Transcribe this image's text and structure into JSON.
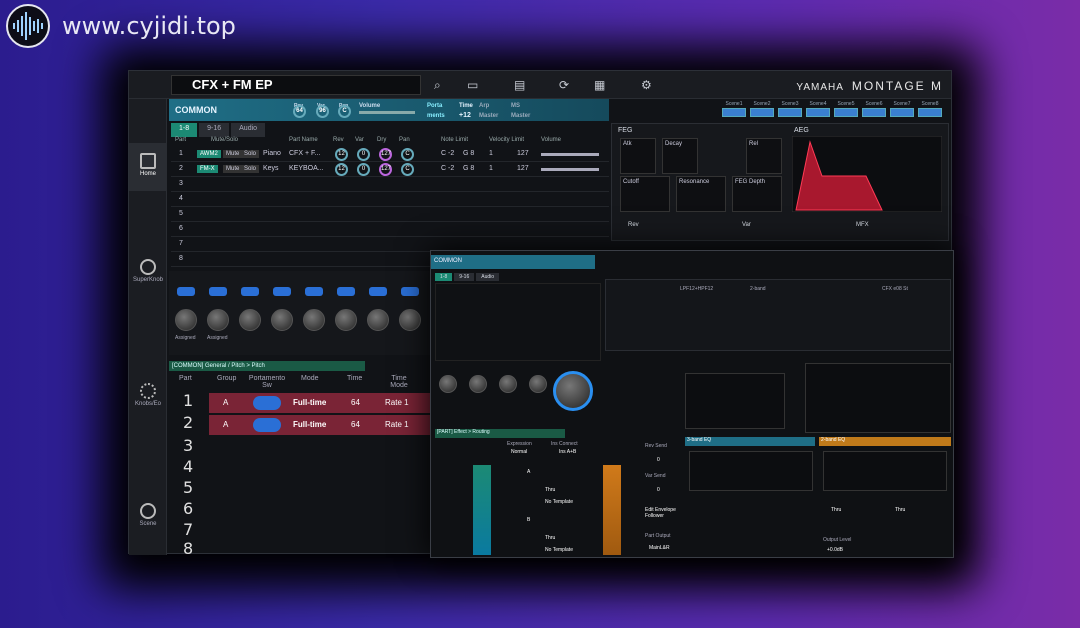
{
  "site": {
    "url": "www.cyjidi.top"
  },
  "topbar": {
    "performance_name": "CFX + FM EP",
    "brand": "YAMAHA",
    "model": "MONTAGE M"
  },
  "sidebar": {
    "items": [
      {
        "label": "Home"
      },
      {
        "label": "SuperKnob"
      },
      {
        "label": "Knobs/Eo"
      },
      {
        "label": "Scene"
      }
    ]
  },
  "common_bar": {
    "label": "COMMON",
    "rev_label": "Rev",
    "rev_value": "64",
    "var_label": "Var",
    "var_value": "96",
    "pan_label": "Pan",
    "pan_value": "C",
    "volume_label": "Volume",
    "porta_label": "Porta",
    "porta_value": "ments",
    "time_label": "Time",
    "time_value": "+12",
    "arp_label": "Arp",
    "arp_value": "Master",
    "ms_label": "MS",
    "ms_value": "Master"
  },
  "scenes": [
    "Scene1",
    "Scene2",
    "Scene3",
    "Scene4",
    "Scene5",
    "Scene6",
    "Scene7",
    "Scene8"
  ],
  "tabs": [
    "1-8",
    "9-16",
    "Audio"
  ],
  "part_table": {
    "headers": [
      "Part",
      "Mute/Solo",
      "Part Name",
      "Rev",
      "Var",
      "Dry",
      "Pan",
      "Note Limit",
      "Velocity Limit",
      "Volume"
    ],
    "rows": [
      {
        "num": "1",
        "type": "AWM2",
        "mute": "Mute",
        "solo": "Solo",
        "cat": "Piano",
        "name": "CFX + F...",
        "rev": "12",
        "var": "0",
        "dry": "127",
        "pan": "C",
        "note_lo": "C -2",
        "note_hi": "G 8",
        "vel_lo": "1",
        "vel_hi": "127"
      },
      {
        "num": "2",
        "type": "FM-X",
        "mute": "Mute",
        "solo": "Solo",
        "cat": "Keys",
        "name": "KEYBOA...",
        "rev": "12",
        "var": "0",
        "dry": "127",
        "pan": "C",
        "note_lo": "C -2",
        "note_hi": "G 8",
        "vel_lo": "1",
        "vel_hi": "127"
      }
    ],
    "empty_rows": [
      "3",
      "4",
      "5",
      "6",
      "7",
      "8"
    ]
  },
  "knob_labels": [
    "Assigned",
    "Assigned"
  ],
  "general": {
    "title": "[COMMON] General / Pitch > Pitch",
    "headers": [
      "Part",
      "Group",
      "Portamento Sw",
      "Mode",
      "Time",
      "Time Mode"
    ],
    "rows": [
      {
        "num": "1",
        "group": "A",
        "mode": "Full-time",
        "time": "64",
        "time_mode": "Rate 1"
      },
      {
        "num": "2",
        "group": "A",
        "mode": "Full-time",
        "time": "64",
        "time_mode": "Rate 1"
      }
    ],
    "empty_rows": [
      "3",
      "4",
      "5",
      "6",
      "7",
      "8"
    ]
  },
  "feg": {
    "title": "FEG",
    "atk": "Atk",
    "decay": "Decay",
    "rel": "Rel",
    "cutoff": "Cutoff",
    "resonance": "Resonance",
    "depth": "FEG Depth"
  },
  "aeg": {
    "title": "AEG"
  },
  "fx_row": {
    "rev": "Rev",
    "var": "Var",
    "mfx": "MFX"
  },
  "overlay": {
    "title": "COMMON",
    "tabs": [
      "1-8",
      "9-16",
      "Audio"
    ],
    "effect_title": "[PART] Effect > Routing",
    "expression": "Expression",
    "expression_value": "Normal",
    "ins_connect": "Ins Connect",
    "ins_connect_value": "Ins A+B",
    "a_label": "A",
    "b_label": "B",
    "type_thru": "Thru",
    "no_template": "No Template",
    "rev_send": "Rev Send",
    "var_send": "Var Send",
    "rev_send_value": "0",
    "var_send_value": "0",
    "part_output": "Part Output",
    "part_output_value": "MainL&R",
    "eq_title": "3-band EQ",
    "eq2_title": "2-band EQ",
    "edit_envelope": "Edit Envelope Follower",
    "filter_type": "LPF12+HPF12",
    "eq_type": "2-band",
    "waveform": "CFX e08 St",
    "output_level": "Output Level",
    "output_value": "+0.0dB",
    "eq_thru1": "Thru",
    "eq_thru2": "Thru"
  }
}
